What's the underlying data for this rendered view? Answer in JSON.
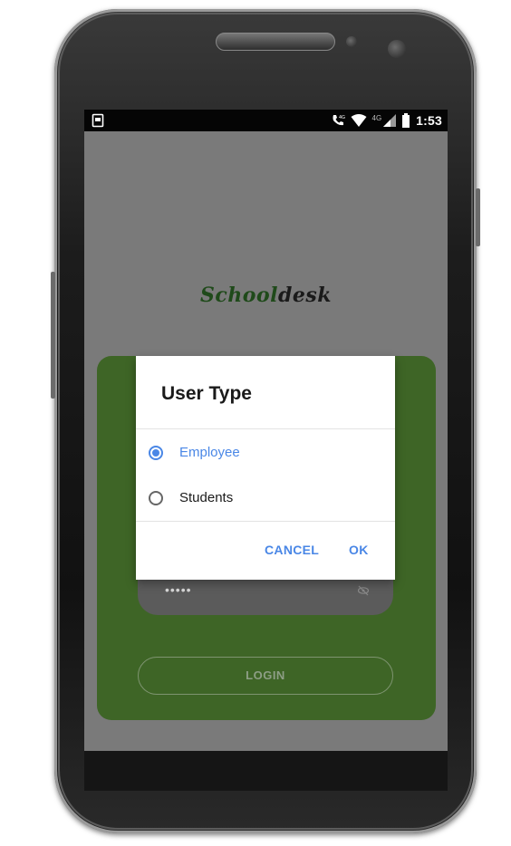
{
  "status_bar": {
    "time": "1:53",
    "network_label": "4G"
  },
  "app": {
    "title_part1": "School",
    "title_part2": "desk",
    "password_masked": "•••••",
    "login_label": "LOGIN",
    "card_color": "#3e6526"
  },
  "dialog": {
    "title": "User Type",
    "options": [
      {
        "label": "Employee",
        "selected": true
      },
      {
        "label": "Students",
        "selected": false
      }
    ],
    "cancel_label": "CANCEL",
    "ok_label": "OK",
    "accent_color": "#4a87e6"
  },
  "icons": {
    "status_left": "screenshot-icon",
    "call": "wifi-call-icon",
    "wifi": "wifi-icon",
    "signal": "signal-icon",
    "battery": "battery-icon",
    "eye": "eye-off-icon"
  }
}
